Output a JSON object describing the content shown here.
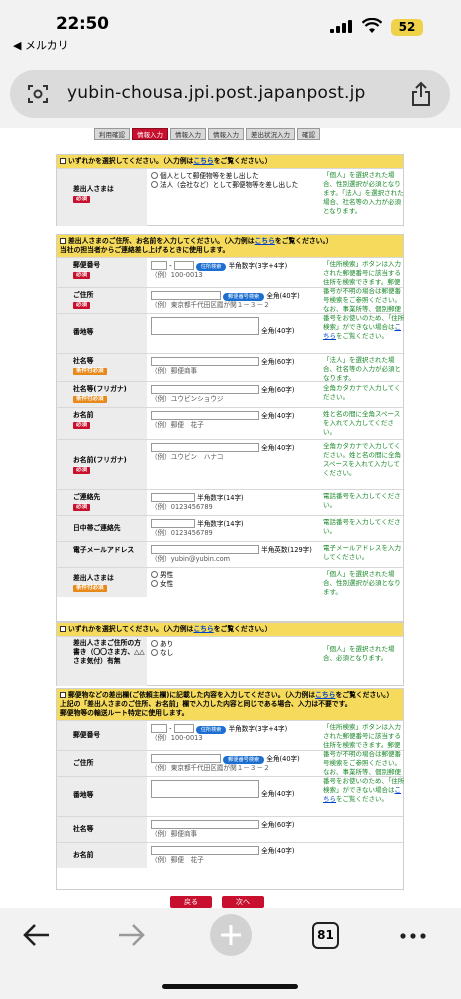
{
  "status": {
    "time": "22:50",
    "back_app": "◀ メルカリ",
    "battery": "52"
  },
  "browser": {
    "url": "yubin-chousa.jpi.post.japanpost.jp",
    "tab_count": "81"
  },
  "steps": [
    "利用確認",
    "情報入力",
    "情報入力",
    "情報入力",
    "差出状況入力",
    "確認"
  ],
  "badges": {
    "required": "必須",
    "conditional": "条件付必須",
    "address_search": "住所検索",
    "postal_search": "郵便番号検索"
  },
  "section1": {
    "header": "いずれかを選択してください。（入力例は",
    "header_link": "こちら",
    "header_tail": "をご覧ください。）",
    "label": "差出人さまは",
    "options": [
      "個人として郵便物等を差し出した",
      "法人（会社など）として郵便物等を差し出した"
    ],
    "note": "「個人」を選択された場合、性別選択が必須となります。「法人」を選択された場合、社名等の入力が必須となります。"
  },
  "section2": {
    "header": "差出人さまのご住所、お名前を入力してください。（入力例は",
    "header_link": "こちら",
    "header_tail": "をご覧ください。）",
    "subheader": "当社の担当者からご連絡差し上げるときに使用します。",
    "rows": {
      "postal": {
        "label": "郵便番号",
        "hint": "半角数字(3字+4字)",
        "example": "（例）100-0013",
        "note": "「住所検索」ボタンは入力された郵便番号に該当する住所を検索できます。郵便番号が不明の場合は郵便番号検索をご参照ください。なお、事業所等、個別郵便番号をお使いのため、「住所検索」ができない場合は",
        "note_link": "こちら",
        "note_tail": "をご覧ください。"
      },
      "address": {
        "label": "ご住所",
        "hint": "全角(40字)",
        "example": "（例）東京都千代田区霞が関１－３－２"
      },
      "banchi": {
        "label": "番地等",
        "hint": "全角(40字)"
      },
      "company": {
        "label": "社名等",
        "hint": "全角(60字)",
        "example": "（例）郵便商事",
        "note": "「法人」を選択された場合、社名等の入力が必須となります。"
      },
      "company_kana": {
        "label": "社名等(フリガナ)",
        "hint": "全角(60字)",
        "example": "（例）ユウビンショウジ",
        "note": "全角カタカナで入力してください。"
      },
      "name": {
        "label": "お名前",
        "hint": "全角(40字)",
        "example": "（例）郵便　花子",
        "note": "姓と名の間に全角スペースを入れて入力してください。"
      },
      "name_kana": {
        "label": "お名前(フリガナ)",
        "hint": "全角(40字)",
        "example": "（例）ユウビン　ハナコ",
        "note": "全角カタカナで入力してください。姓と名の間に全角スペースを入れて入力してください。"
      },
      "phone": {
        "label": "ご連絡先",
        "hint": "半角数字(14字)",
        "example": "（例）0123456789",
        "note": "電話番号を入力してください。"
      },
      "day_phone": {
        "label": "日中帯ご連絡先",
        "hint": "半角数字(14字)",
        "example": "（例）0123456789",
        "note": "電話番号を入力してください。"
      },
      "email": {
        "label": "電子メールアドレス",
        "hint": "半角英数(129字)",
        "example": "（例）yubin@yubin.com",
        "note": "電子メールアドレスを入力してください。"
      },
      "gender": {
        "label": "差出人さまは",
        "options": [
          "男性",
          "女性"
        ],
        "note": "「個人」を選択された場合、性別選択が必須となります。"
      }
    }
  },
  "section3": {
    "header": "いずれかを選択してください。（入力例は",
    "header_link": "こちら",
    "header_tail": "をご覧ください。）",
    "label": "差出人さまご住所の方書き（〇〇さま方、△△さま気付）有無",
    "options": [
      "あり",
      "なし"
    ],
    "note": "「個人」を選択された場合、必須となります。"
  },
  "section4": {
    "header": "郵便物などの差出欄(ご依頼主欄)に記載した内容を入力してください。（入力例は",
    "header_link": "こちら",
    "header_tail": "をご覧ください。）",
    "sub1": "上記の「差出人さまのご住所、お名前」欄で入力した内容と同じである場合、入力は不要です。",
    "sub2": "郵便物等の輸送ルート特定に使用します。",
    "rows": {
      "postal": {
        "label": "郵便番号",
        "hint": "半角数字(3字+4字)",
        "example": "（例）100-0013",
        "note": "「住所検索」ボタンは入力された郵便番号に該当する住所を検索できます。郵便番号が不明の場合は郵便番号検索をご参照ください。なお、事業所等、個別郵便番号をお使いのため、「住所検索」ができない場合は",
        "note_link": "こちら",
        "note_tail": "をご覧ください。"
      },
      "address": {
        "label": "ご住所",
        "hint": "全角(40字)",
        "example": "（例）東京都千代田区霞が関１－３－２"
      },
      "banchi": {
        "label": "番地等",
        "hint": "全角(40字)"
      },
      "company": {
        "label": "社名等",
        "hint": "全角(60字)",
        "example": "（例）郵便商事"
      },
      "name": {
        "label": "お名前",
        "hint": "全角(40字)",
        "example": "（例）郵便　花子"
      }
    }
  },
  "buttons": {
    "back": "戻る",
    "next": "次へ"
  }
}
